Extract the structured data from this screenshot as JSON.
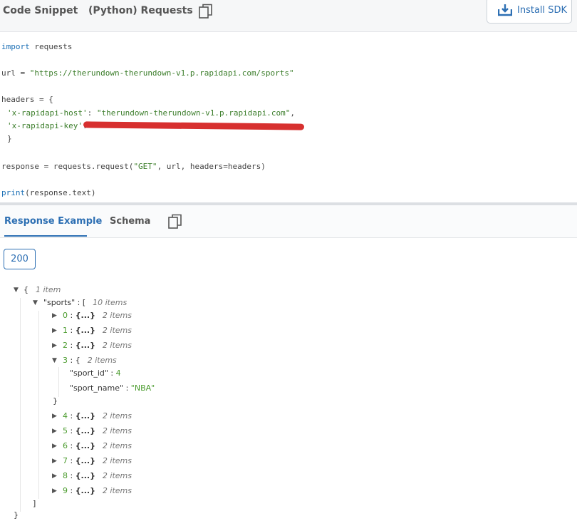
{
  "header": {
    "title": "Code Snippet",
    "language": "(Python) Requests",
    "sdk_label": "Install SDK"
  },
  "code": {
    "l1_kw": "import",
    "l1_rest": " requests",
    "l2_var": "url",
    "l2_eq": " = ",
    "l2_str": "\"https://therundown-therundown-v1.p.rapidapi.com/sports\"",
    "l3": "headers = {",
    "l4_key": "'x-rapidapi-host'",
    "l4_sep": ": ",
    "l4_val": "\"therundown-therundown-v1.p.rapidapi.com\"",
    "l4_comma": ",",
    "l5_key": "'x-rapidapi-key'",
    "l5_sep": ": ",
    "l6": "}",
    "l7_a": "response = requests.request(",
    "l7_s": "\"GET\"",
    "l7_b": ", url, headers=headers)",
    "l8_kw": "print",
    "l8_rest": "(response.text)"
  },
  "tabs": {
    "response": "Response Example",
    "schema": "Schema"
  },
  "status_code": "200",
  "tree": {
    "root_open": "{",
    "root_count": "1 item",
    "sports_key": "\"sports\" : [",
    "sports_count": "10 items",
    "items": [
      {
        "idx": "0",
        "count": "2 items"
      },
      {
        "idx": "1",
        "count": "2 items"
      },
      {
        "idx": "2",
        "count": "2 items"
      },
      {
        "idx": "3",
        "count": "2 items"
      },
      {
        "idx": "4",
        "count": "2 items"
      },
      {
        "idx": "5",
        "count": "2 items"
      },
      {
        "idx": "6",
        "count": "2 items"
      },
      {
        "idx": "7",
        "count": "2 items"
      },
      {
        "idx": "8",
        "count": "2 items"
      },
      {
        "idx": "9",
        "count": "2 items"
      }
    ],
    "collapsed_obj": "{...}",
    "expanded_open": "{",
    "sport_id_key": "\"sport_id\"",
    "sport_id_val": "4",
    "sport_name_key": "\"sport_name\"",
    "sport_name_val": "\"NBA\"",
    "close_brace": "}",
    "close_bracket": "]",
    "root_close": "}"
  },
  "colors": {
    "accent": "#2d6fb3",
    "value_green": "#4a9b2d",
    "redaction": "#d7302f"
  }
}
